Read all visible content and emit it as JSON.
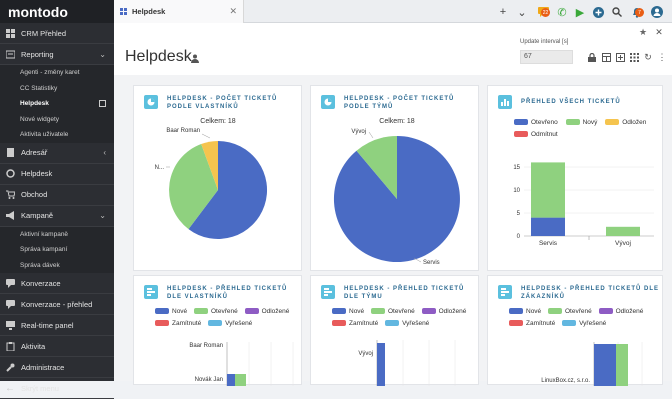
{
  "brand": {
    "logo": "montodo"
  },
  "sidebar": {
    "items": [
      {
        "key": "crm",
        "label": "CRM Přehled"
      },
      {
        "key": "reporting",
        "label": "Reporting"
      },
      {
        "key": "adresar",
        "label": "Adresář"
      },
      {
        "key": "helpdesk",
        "label": "Helpdesk"
      },
      {
        "key": "obchod",
        "label": "Obchod"
      },
      {
        "key": "kampane",
        "label": "Kampaně"
      },
      {
        "key": "konverzace",
        "label": "Konverzace"
      },
      {
        "key": "konverzace-prehled",
        "label": "Konverzace - přehled"
      },
      {
        "key": "realtime",
        "label": "Real-time panel"
      },
      {
        "key": "aktivita",
        "label": "Aktivita"
      },
      {
        "key": "administrace",
        "label": "Administrace"
      },
      {
        "key": "skryt",
        "label": "Skrýt menu"
      }
    ],
    "reporting_sub": [
      "Agenti - změny karet",
      "CC Statistiky",
      "Helpdesk",
      "Nové widgety",
      "Aktivita uživatele"
    ],
    "kampane_sub": [
      "Aktivní kampaně",
      "Správa kampaní",
      "Správa dávek"
    ]
  },
  "topbar": {
    "tab_label": "Helpdesk",
    "chat_badge": "22",
    "notif_badge": "7"
  },
  "page": {
    "title": "Helpdesk",
    "update_label": "Update interval [s]",
    "update_value": "67"
  },
  "panels": {
    "p1": {
      "title": "Helpdesk - počet ticketů podle vlastníků",
      "total": "Celkem: 18",
      "label_a": "Baar Roman",
      "label_b": "N..."
    },
    "p2": {
      "title": "Helpdesk - počet ticketů podle týmů",
      "total": "Celkem: 18",
      "label_a": "Vývoj",
      "label_b": "Servis"
    },
    "p3": {
      "title": "Přehled všech ticketů"
    },
    "p4": {
      "title": "Helpdesk - přehled ticketů dle vlastníků",
      "row1": "Baar Roman",
      "row2": "Novák Jan"
    },
    "p5": {
      "title": "Helpdesk - přehled ticketů dle týmu",
      "row1": "Vývoj"
    },
    "p6": {
      "title": "Helpdesk - přehled ticketů dle zákazníků",
      "row1": "LinuxBox.cz, s.r.o."
    }
  },
  "legend3": [
    "Otevřeno",
    "Nový",
    "Odložen",
    "Odmítnut"
  ],
  "legend5": [
    "Nové",
    "Otevřené",
    "Odložené",
    "Zamítnuté",
    "Vyřešené"
  ],
  "colors": {
    "blue": "#4a6bc4",
    "green": "#8fd17f",
    "yellow": "#f5c44e",
    "red": "#e85b5b",
    "purple": "#8e5cc4",
    "cyan": "#62b7e0"
  },
  "chart_data": [
    {
      "type": "pie",
      "title": "Helpdesk - počet ticketů podle vlastníků",
      "subtitle": "Celkem: 18",
      "categories": [
        "Baar Roman",
        "N..."
      ],
      "values": [
        1,
        5
      ]
    },
    {
      "type": "pie",
      "title": "Helpdesk - počet ticketů podle týmů",
      "subtitle": "Celkem: 18",
      "categories": [
        "Vývoj",
        "Servis"
      ],
      "values": [
        2,
        16
      ]
    },
    {
      "type": "bar",
      "title": "Přehled všech ticketů",
      "categories": [
        "Servis",
        "Vývoj"
      ],
      "series": [
        {
          "name": "Otevřeno",
          "values": [
            4,
            0
          ]
        },
        {
          "name": "Nový",
          "values": [
            12,
            2
          ]
        }
      ],
      "ylim": [
        0,
        20
      ],
      "yticks": [
        0,
        5,
        10,
        15
      ]
    }
  ]
}
